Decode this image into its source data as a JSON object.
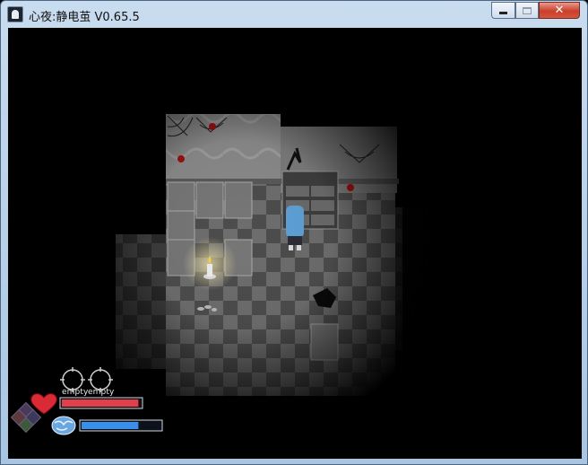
{
  "window": {
    "title": "心夜:静电茧 V0.65.5",
    "buttons": {
      "minimize": "minimize",
      "maximize": "maximize",
      "close": "✕"
    }
  },
  "hud": {
    "slots": [
      {
        "label": "empty",
        "icon": "empty-slot-ring-icon"
      },
      {
        "label": "empty",
        "icon": "empty-slot-ring-icon"
      }
    ],
    "health": {
      "icon": "heart-icon",
      "fraction": 0.97,
      "color": "#e0404a"
    },
    "stamina": {
      "icon": "brain-icon",
      "fraction": 0.72,
      "color": "#3a8fe8"
    },
    "dpad_icon": "dpad-icon"
  },
  "scene": {
    "player_icon": "blue-haired-girl-sprite",
    "props": [
      "cobweb-icon",
      "spider-icon",
      "candle-icon",
      "cabinet-icon",
      "crate-icon",
      "bone-pile-icon"
    ]
  }
}
